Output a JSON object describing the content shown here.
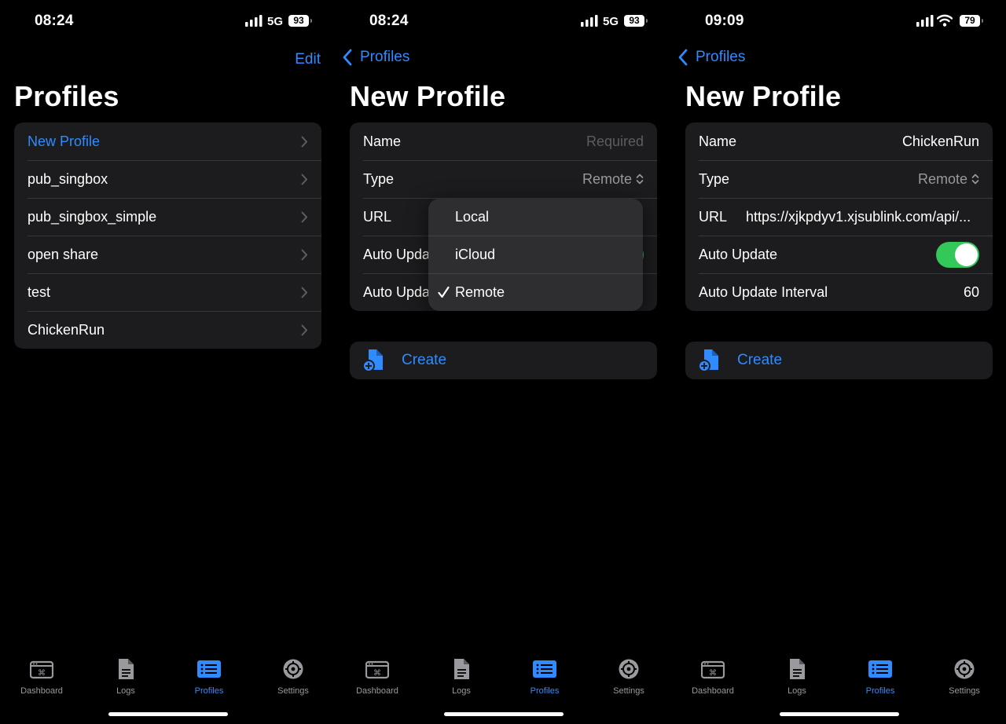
{
  "screens": [
    {
      "time": "08:24",
      "network": "5G",
      "battery": "93",
      "nav_action": "Edit",
      "title": "Profiles",
      "profiles": [
        "New Profile",
        "pub_singbox",
        "pub_singbox_simple",
        "open share",
        "test",
        "ChickenRun"
      ]
    },
    {
      "time": "08:24",
      "network": "5G",
      "battery": "93",
      "back_label": "Profiles",
      "title": "New Profile",
      "fields": {
        "name_label": "Name",
        "name_placeholder": "Required",
        "type_label": "Type",
        "type_value": "Remote",
        "url_label": "URL",
        "auto_update_label": "Auto Upda",
        "interval_label": "Auto Upda"
      },
      "type_menu": {
        "options": [
          "Local",
          "iCloud",
          "Remote"
        ],
        "selected": "Remote"
      },
      "create_label": "Create"
    },
    {
      "time": "09:09",
      "battery": "79",
      "back_label": "Profiles",
      "title": "New Profile",
      "fields": {
        "name_label": "Name",
        "name_value": "ChickenRun",
        "type_label": "Type",
        "type_value": "Remote",
        "url_label": "URL",
        "url_value": "https://xjkpdyv1.xjsublink.com/api/...",
        "auto_update_label": "Auto Update",
        "auto_update_on": true,
        "interval_label": "Auto Update Interval",
        "interval_value": "60"
      },
      "create_label": "Create"
    }
  ],
  "tabbar": {
    "tabs": [
      {
        "label": "Dashboard",
        "icon": "dashboard-icon"
      },
      {
        "label": "Logs",
        "icon": "document-icon"
      },
      {
        "label": "Profiles",
        "icon": "list-icon"
      },
      {
        "label": "Settings",
        "icon": "gear-icon"
      }
    ],
    "active": "Profiles"
  },
  "colors": {
    "accent": "#2f8bff",
    "toggle_on": "#34c759",
    "cell_background": "#1c1c1e",
    "background": "#000000"
  }
}
